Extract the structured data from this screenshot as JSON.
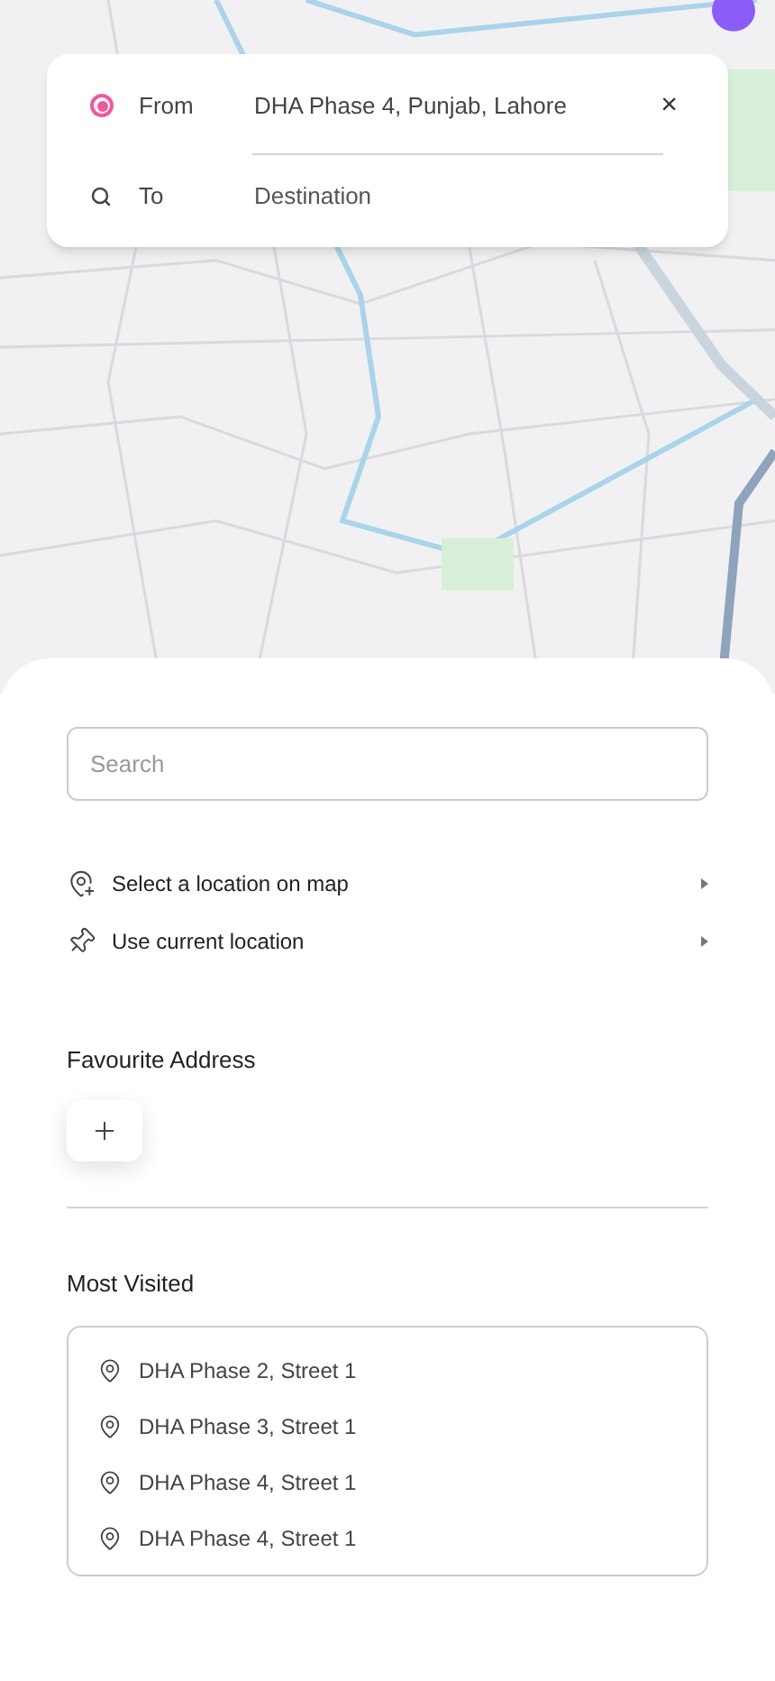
{
  "route": {
    "from": {
      "label": "From",
      "value": "DHA Phase 4, Punjab, Lahore",
      "clear": "×"
    },
    "to": {
      "label": "To",
      "placeholder": "Destination"
    }
  },
  "search": {
    "placeholder": "Search"
  },
  "options": [
    {
      "kind": "map",
      "label": "Select a location on map"
    },
    {
      "kind": "current",
      "label": "Use current location"
    }
  ],
  "favourites": {
    "title": "Favourite Address"
  },
  "most_visited": {
    "title": "Most Visited",
    "items": [
      "DHA Phase 2, Street 1",
      "DHA Phase 3, Street 1",
      "DHA Phase 4, Street 1",
      "DHA Phase 4, Street 1"
    ]
  }
}
